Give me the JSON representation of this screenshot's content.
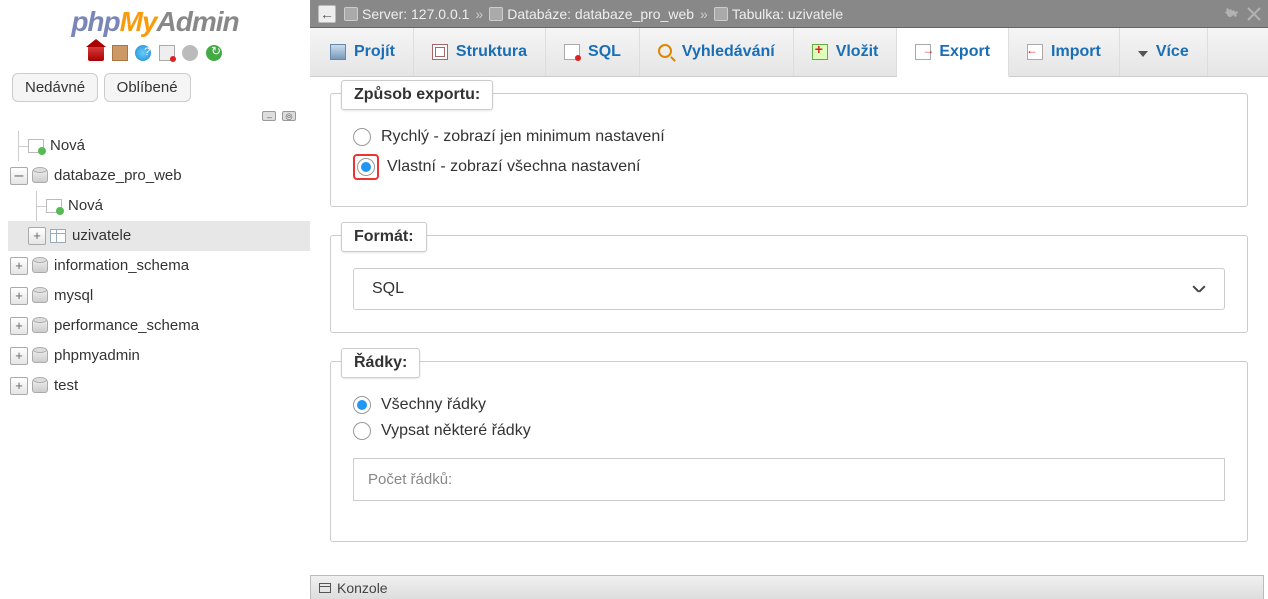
{
  "logo": {
    "p1": "php",
    "p2": "My",
    "p3": "Admin"
  },
  "sidebar": {
    "recent": "Nedávné",
    "favorites": "Oblíbené",
    "new_top": "Nová",
    "items": [
      {
        "label": "databaze_pro_web"
      },
      {
        "label": "Nová"
      },
      {
        "label": "uzivatele"
      },
      {
        "label": "information_schema"
      },
      {
        "label": "mysql"
      },
      {
        "label": "performance_schema"
      },
      {
        "label": "phpmyadmin"
      },
      {
        "label": "test"
      }
    ]
  },
  "breadcrumb": {
    "server_lbl": "Server: ",
    "server_val": "127.0.0.1",
    "db_lbl": "Databáze: ",
    "db_val": "databaze_pro_web",
    "tbl_lbl": "Tabulka: ",
    "tbl_val": "uzivatele"
  },
  "tabs": {
    "browse": "Projít",
    "structure": "Struktura",
    "sql": "SQL",
    "search": "Vyhledávání",
    "insert": "Vložit",
    "export": "Export",
    "import": "Import",
    "more": "Více"
  },
  "export_method": {
    "legend": "Způsob exportu:",
    "quick": "Rychlý - zobrazí jen minimum nastavení",
    "custom": "Vlastní - zobrazí všechna nastavení"
  },
  "format": {
    "legend": "Formát:",
    "value": "SQL"
  },
  "rows": {
    "legend": "Řádky:",
    "all": "Všechny řádky",
    "some": "Vypsat některé řádky",
    "count_label": "Počet řádků:"
  },
  "console": "Konzole"
}
